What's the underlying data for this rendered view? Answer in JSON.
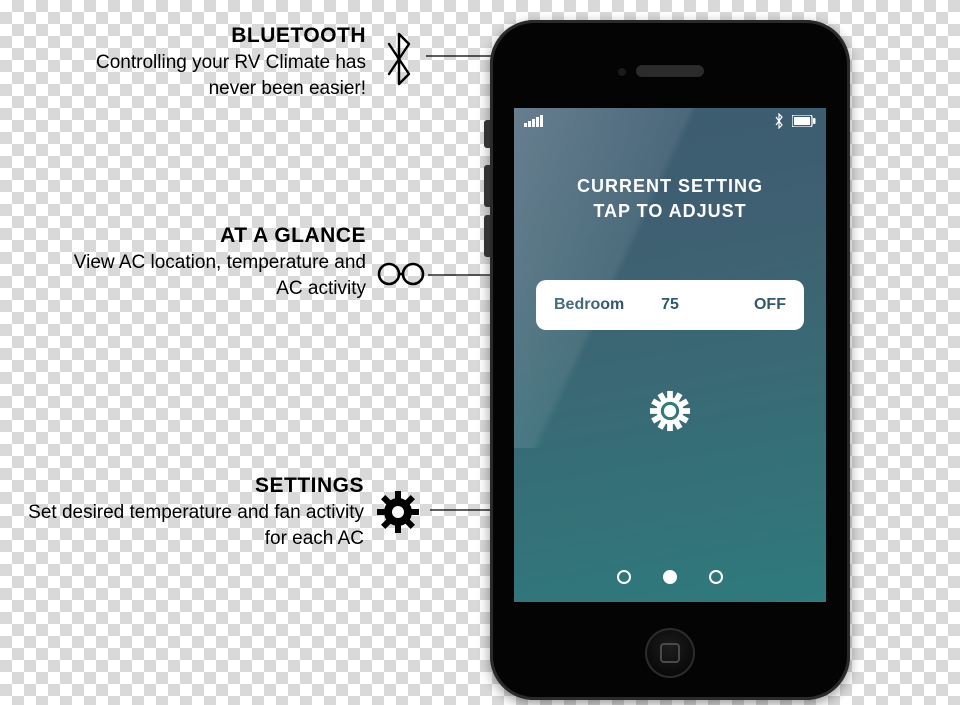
{
  "callouts": {
    "bluetooth": {
      "heading": "BLUETOOTH",
      "body": "Controlling your RV Climate has never been easier!"
    },
    "glance": {
      "heading": "AT A GLANCE",
      "body": "View AC location, temperature and AC activity"
    },
    "settings": {
      "heading": "SETTINGS",
      "body": "Set desired temperature and fan activity for each AC"
    }
  },
  "phone": {
    "header_line1": "CURRENT SETTING",
    "header_line2": "TAP TO ADJUST",
    "card": {
      "room": "Bedroom",
      "temp": "75",
      "state": "OFF"
    },
    "pager": {
      "index": 1,
      "count": 3
    }
  },
  "icons": {
    "bluetooth": "bluetooth-icon",
    "glasses": "glasses-icon",
    "gear": "gear-icon",
    "signal": "signal-icon",
    "battery": "battery-icon"
  }
}
